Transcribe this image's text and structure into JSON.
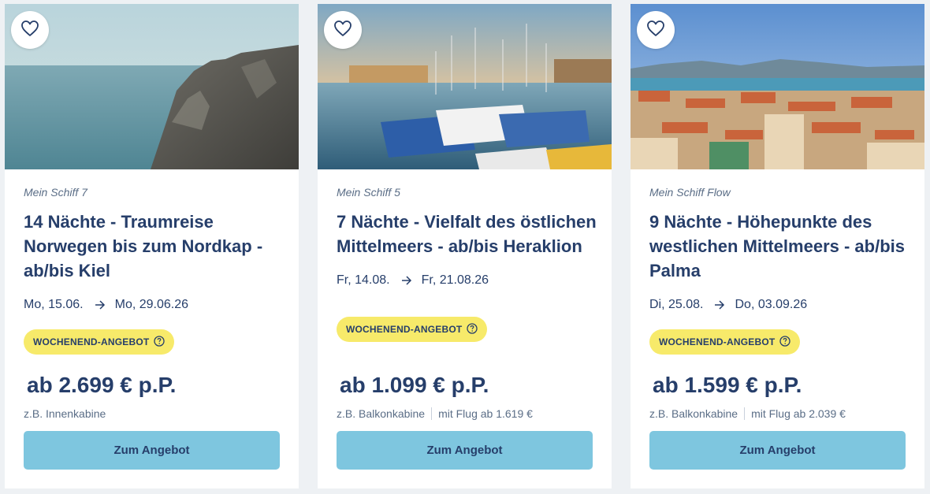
{
  "offers": [
    {
      "ship": "Mein Schiff 7",
      "title": "14 Nächte - Traumreise Norwegen bis zum Nordkap - ab/bis Kiel",
      "date_from": "Mo, 15.06.",
      "date_to": "Mo, 29.06.26",
      "badge": "WOCHENEND-ANGEBOT",
      "price": "ab 2.699 € p.P.",
      "cabin": "z.B. Innenkabine",
      "flight": "",
      "cta": "Zum Angebot"
    },
    {
      "ship": "Mein Schiff 5",
      "title": "7 Nächte - Vielfalt des östlichen Mittelmeers - ab/bis Heraklion",
      "date_from": "Fr, 14.08.",
      "date_to": "Fr, 21.08.26",
      "badge": "WOCHENEND-ANGEBOT",
      "price": "ab 1.099 € p.P.",
      "cabin": "z.B. Balkonkabine",
      "flight": "mit Flug ab 1.619 €",
      "cta": "Zum Angebot"
    },
    {
      "ship": "Mein Schiff Flow",
      "title": "9 Nächte - Höhepunkte des westlichen Mittelmeers - ab/bis Palma",
      "date_from": "Di, 25.08.",
      "date_to": "Do, 03.09.26",
      "badge": "WOCHENEND-ANGEBOT",
      "price": "ab 1.599 € p.P.",
      "cabin": "z.B. Balkonkabine",
      "flight": "mit Flug ab 2.039 €",
      "cta": "Zum Angebot"
    }
  ],
  "colors": {
    "text": "#263e6a",
    "badge": "#f7ea6a",
    "button": "#7ec6df"
  },
  "icons": {
    "favorite": "heart-icon",
    "date_separator": "arrow-right-icon",
    "badge_info": "info-icon"
  }
}
